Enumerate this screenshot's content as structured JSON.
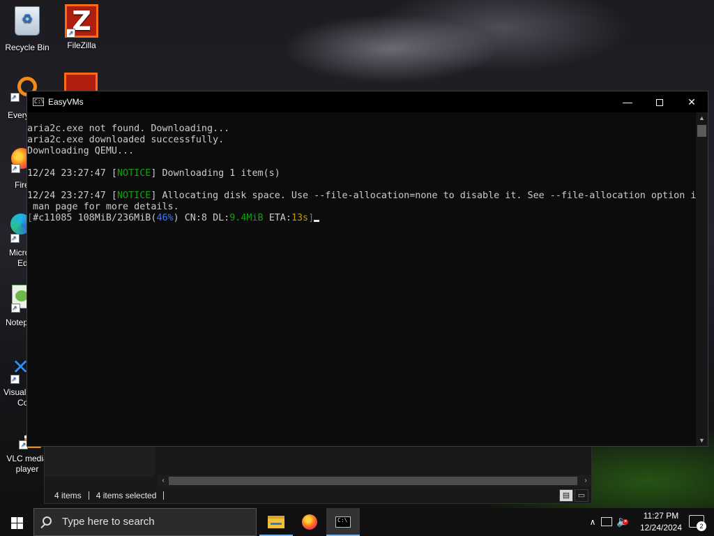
{
  "desktop": {
    "icons": [
      {
        "label": "Recycle Bin",
        "icon": "recycle-bin-icon"
      },
      {
        "label": "FileZilla",
        "icon": "filezilla-icon"
      },
      {
        "label": "Every",
        "icon": "everything-icon"
      },
      {
        "label": "Fire",
        "icon": "firefox-icon"
      },
      {
        "label": "Micro",
        "label2": "Ed",
        "icon": "edge-icon"
      },
      {
        "label": "Notep",
        "icon": "notepad-icon"
      },
      {
        "label": "Visual",
        "label2": "Co",
        "icon": "vscode-icon"
      },
      {
        "label": "VLC media",
        "label2": "player",
        "icon": "vlc-icon"
      }
    ]
  },
  "console": {
    "title": "EasyVMs",
    "lines": {
      "l1": "aria2c.exe not found. Downloading...",
      "l2": "aria2c.exe downloaded successfully.",
      "l3": "Downloading QEMU...",
      "l4_ts": "12/24 23:27:47",
      "l4_tag": "NOTICE",
      "l4_msg": " Downloading 1 item(s)",
      "l5_ts": "12/24 23:27:47",
      "l5_tag": "NOTICE",
      "l5_msg": " Allocating disk space. Use --file-allocation=none to disable it. See --file-allocation option in",
      "l6": " man page for more details.",
      "progress": {
        "gid": "#c11085",
        "size": "108MiB/236MiB",
        "pct": "46%",
        "cn": "CN:8",
        "dl_label": "DL:",
        "dl_value": "9.4MiB",
        "eta_label": "ETA:",
        "eta_value": "13s",
        "fraction": 0.46
      }
    },
    "controls": {
      "minimize": "—",
      "close": "✕"
    }
  },
  "explorer": {
    "items_count": "4 items",
    "selected": "4 items selected"
  },
  "taskbar": {
    "search_placeholder": "Type here to search",
    "time": "11:27 PM",
    "date": "12/24/2024",
    "notifications": "2"
  },
  "colors": {
    "notice": "#13a10e",
    "percent": "#3b78ff",
    "eta": "#c19c00"
  }
}
